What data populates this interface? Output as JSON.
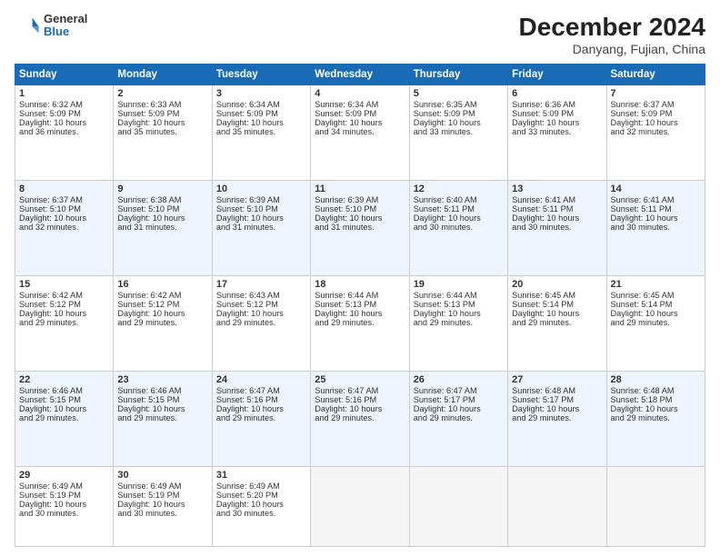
{
  "logo": {
    "general": "General",
    "blue": "Blue"
  },
  "title": {
    "month_year": "December 2024",
    "location": "Danyang, Fujian, China"
  },
  "weekdays": [
    "Sunday",
    "Monday",
    "Tuesday",
    "Wednesday",
    "Thursday",
    "Friday",
    "Saturday"
  ],
  "weeks": [
    [
      {
        "day": "1",
        "lines": [
          "Sunrise: 6:32 AM",
          "Sunset: 5:09 PM",
          "Daylight: 10 hours",
          "and 36 minutes."
        ]
      },
      {
        "day": "2",
        "lines": [
          "Sunrise: 6:33 AM",
          "Sunset: 5:09 PM",
          "Daylight: 10 hours",
          "and 35 minutes."
        ]
      },
      {
        "day": "3",
        "lines": [
          "Sunrise: 6:34 AM",
          "Sunset: 5:09 PM",
          "Daylight: 10 hours",
          "and 35 minutes."
        ]
      },
      {
        "day": "4",
        "lines": [
          "Sunrise: 6:34 AM",
          "Sunset: 5:09 PM",
          "Daylight: 10 hours",
          "and 34 minutes."
        ]
      },
      {
        "day": "5",
        "lines": [
          "Sunrise: 6:35 AM",
          "Sunset: 5:09 PM",
          "Daylight: 10 hours",
          "and 33 minutes."
        ]
      },
      {
        "day": "6",
        "lines": [
          "Sunrise: 6:36 AM",
          "Sunset: 5:09 PM",
          "Daylight: 10 hours",
          "and 33 minutes."
        ]
      },
      {
        "day": "7",
        "lines": [
          "Sunrise: 6:37 AM",
          "Sunset: 5:09 PM",
          "Daylight: 10 hours",
          "and 32 minutes."
        ]
      }
    ],
    [
      {
        "day": "8",
        "lines": [
          "Sunrise: 6:37 AM",
          "Sunset: 5:10 PM",
          "Daylight: 10 hours",
          "and 32 minutes."
        ]
      },
      {
        "day": "9",
        "lines": [
          "Sunrise: 6:38 AM",
          "Sunset: 5:10 PM",
          "Daylight: 10 hours",
          "and 31 minutes."
        ]
      },
      {
        "day": "10",
        "lines": [
          "Sunrise: 6:39 AM",
          "Sunset: 5:10 PM",
          "Daylight: 10 hours",
          "and 31 minutes."
        ]
      },
      {
        "day": "11",
        "lines": [
          "Sunrise: 6:39 AM",
          "Sunset: 5:10 PM",
          "Daylight: 10 hours",
          "and 31 minutes."
        ]
      },
      {
        "day": "12",
        "lines": [
          "Sunrise: 6:40 AM",
          "Sunset: 5:11 PM",
          "Daylight: 10 hours",
          "and 30 minutes."
        ]
      },
      {
        "day": "13",
        "lines": [
          "Sunrise: 6:41 AM",
          "Sunset: 5:11 PM",
          "Daylight: 10 hours",
          "and 30 minutes."
        ]
      },
      {
        "day": "14",
        "lines": [
          "Sunrise: 6:41 AM",
          "Sunset: 5:11 PM",
          "Daylight: 10 hours",
          "and 30 minutes."
        ]
      }
    ],
    [
      {
        "day": "15",
        "lines": [
          "Sunrise: 6:42 AM",
          "Sunset: 5:12 PM",
          "Daylight: 10 hours",
          "and 29 minutes."
        ]
      },
      {
        "day": "16",
        "lines": [
          "Sunrise: 6:42 AM",
          "Sunset: 5:12 PM",
          "Daylight: 10 hours",
          "and 29 minutes."
        ]
      },
      {
        "day": "17",
        "lines": [
          "Sunrise: 6:43 AM",
          "Sunset: 5:12 PM",
          "Daylight: 10 hours",
          "and 29 minutes."
        ]
      },
      {
        "day": "18",
        "lines": [
          "Sunrise: 6:44 AM",
          "Sunset: 5:13 PM",
          "Daylight: 10 hours",
          "and 29 minutes."
        ]
      },
      {
        "day": "19",
        "lines": [
          "Sunrise: 6:44 AM",
          "Sunset: 5:13 PM",
          "Daylight: 10 hours",
          "and 29 minutes."
        ]
      },
      {
        "day": "20",
        "lines": [
          "Sunrise: 6:45 AM",
          "Sunset: 5:14 PM",
          "Daylight: 10 hours",
          "and 29 minutes."
        ]
      },
      {
        "day": "21",
        "lines": [
          "Sunrise: 6:45 AM",
          "Sunset: 5:14 PM",
          "Daylight: 10 hours",
          "and 29 minutes."
        ]
      }
    ],
    [
      {
        "day": "22",
        "lines": [
          "Sunrise: 6:46 AM",
          "Sunset: 5:15 PM",
          "Daylight: 10 hours",
          "and 29 minutes."
        ]
      },
      {
        "day": "23",
        "lines": [
          "Sunrise: 6:46 AM",
          "Sunset: 5:15 PM",
          "Daylight: 10 hours",
          "and 29 minutes."
        ]
      },
      {
        "day": "24",
        "lines": [
          "Sunrise: 6:47 AM",
          "Sunset: 5:16 PM",
          "Daylight: 10 hours",
          "and 29 minutes."
        ]
      },
      {
        "day": "25",
        "lines": [
          "Sunrise: 6:47 AM",
          "Sunset: 5:16 PM",
          "Daylight: 10 hours",
          "and 29 minutes."
        ]
      },
      {
        "day": "26",
        "lines": [
          "Sunrise: 6:47 AM",
          "Sunset: 5:17 PM",
          "Daylight: 10 hours",
          "and 29 minutes."
        ]
      },
      {
        "day": "27",
        "lines": [
          "Sunrise: 6:48 AM",
          "Sunset: 5:17 PM",
          "Daylight: 10 hours",
          "and 29 minutes."
        ]
      },
      {
        "day": "28",
        "lines": [
          "Sunrise: 6:48 AM",
          "Sunset: 5:18 PM",
          "Daylight: 10 hours",
          "and 29 minutes."
        ]
      }
    ],
    [
      {
        "day": "29",
        "lines": [
          "Sunrise: 6:49 AM",
          "Sunset: 5:19 PM",
          "Daylight: 10 hours",
          "and 30 minutes."
        ]
      },
      {
        "day": "30",
        "lines": [
          "Sunrise: 6:49 AM",
          "Sunset: 5:19 PM",
          "Daylight: 10 hours",
          "and 30 minutes."
        ]
      },
      {
        "day": "31",
        "lines": [
          "Sunrise: 6:49 AM",
          "Sunset: 5:20 PM",
          "Daylight: 10 hours",
          "and 30 minutes."
        ]
      },
      {
        "day": "",
        "lines": []
      },
      {
        "day": "",
        "lines": []
      },
      {
        "day": "",
        "lines": []
      },
      {
        "day": "",
        "lines": []
      }
    ]
  ]
}
